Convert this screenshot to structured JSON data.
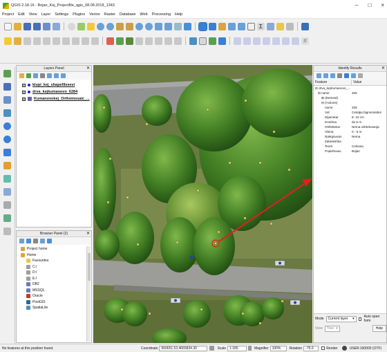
{
  "window": {
    "title": "QGIS 2.18.16 - Bojan_Kej_Projectfile_qgis_08.08.2018_1343",
    "minimize": "–",
    "maximize": "□",
    "close": "×"
  },
  "menu": [
    "Project",
    "Edit",
    "View",
    "Layer",
    "Settings",
    "Plugins",
    "Vector",
    "Raster",
    "Database",
    "Web",
    "Processing",
    "Help"
  ],
  "layers_panel": {
    "title": "Layers Panel",
    "layers": [
      {
        "name": "klupi_kej_shapefileeevi",
        "checked": "x",
        "color": "#1e1ed2"
      },
      {
        "name": "drva_kejkumanovo_6284",
        "checked": "x",
        "color": "#1e1ed2"
      },
      {
        "name": "Kumanovokej_Orthomosaic_...",
        "checked": "x",
        "color": "#7a4a9a"
      }
    ]
  },
  "browser_panel": {
    "title": "Browser Panel (2)",
    "items": [
      {
        "label": "Project home",
        "child": false,
        "icon": "#d9a441"
      },
      {
        "label": "Home",
        "child": false,
        "icon": "#d9a441"
      },
      {
        "label": "Favourites",
        "child": true,
        "icon": "#e8c84a"
      },
      {
        "label": "C:/",
        "child": true,
        "icon": "#9e9e9e"
      },
      {
        "label": "D:/",
        "child": true,
        "icon": "#9e9e9e"
      },
      {
        "label": "E:/",
        "child": true,
        "icon": "#9e9e9e"
      },
      {
        "label": "DB2",
        "child": true,
        "icon": "#6b7bb8"
      },
      {
        "label": "MSSQL",
        "child": true,
        "icon": "#6b7bb8"
      },
      {
        "label": "Oracle",
        "child": true,
        "icon": "#c0392b"
      },
      {
        "label": "PostGIS",
        "child": true,
        "icon": "#336791"
      },
      {
        "label": "SpatiaLite",
        "child": true,
        "icon": "#4a90c2"
      }
    ]
  },
  "identify": {
    "title": "Identify Results",
    "col_feature": "Feature",
    "col_value": "Value",
    "rows": [
      {
        "k": "⊟ drva_kejKumanovo_...",
        "v": "",
        "ind": "2px"
      },
      {
        "k": "⊟ name",
        "v": "325",
        "ind": "6px"
      },
      {
        "k": "⊞ (Derived)",
        "v": "",
        "ind": "11px"
      },
      {
        "k": "⊟ (Actions)",
        "v": "",
        "ind": "11px"
      },
      {
        "k": "name",
        "v": "325",
        "ind": "16px"
      },
      {
        "k": "Vid",
        "v": "Cetalpa bignonioides",
        "ind": "16px"
      },
      {
        "k": "Dijametar",
        "v": "6- 10 cm",
        "ind": "16px"
      },
      {
        "k": "Kroshna",
        "v": "do 5 m",
        "ind": "16px"
      },
      {
        "k": "Oshtetetuv",
        "v": "Nema oshtetuvanja",
        "ind": "16px"
      },
      {
        "k": "Visina",
        "v": "0 - 5 m",
        "ind": "16px"
      },
      {
        "k": "Nalegnuvan",
        "v": "Nema",
        "ind": "16px"
      },
      {
        "k": "Zabeleshka",
        "v": "",
        "ind": "16px"
      },
      {
        "k": "Teren",
        "v": "Celosna",
        "ind": "16px"
      },
      {
        "k": "Popishuvac",
        "v": "Bojan",
        "ind": "16px"
      }
    ],
    "mode_label": "Mode",
    "mode_value": "Current layer",
    "auto_open_label": "Auto open form",
    "view_label": "View",
    "view_value": "Tree",
    "help_label": "Help"
  },
  "status": {
    "message": "No features at this position found.",
    "coordinate_label": "Coordinate",
    "coordinate_value": "560651.52,4665834.30",
    "scale_label": "Scale",
    "scale_value": "1:185",
    "magnifier_label": "Magnifier",
    "magnifier_value": "100%",
    "rotation_label": "Rotation",
    "rotation_value": "-75.0",
    "render_label": "Render",
    "crs_label": "USER:100000 (OTF)"
  },
  "colors": {
    "annotation_arrow": "#e02020",
    "tree_point": "#f0e040",
    "bench_point": "#2040c0"
  }
}
